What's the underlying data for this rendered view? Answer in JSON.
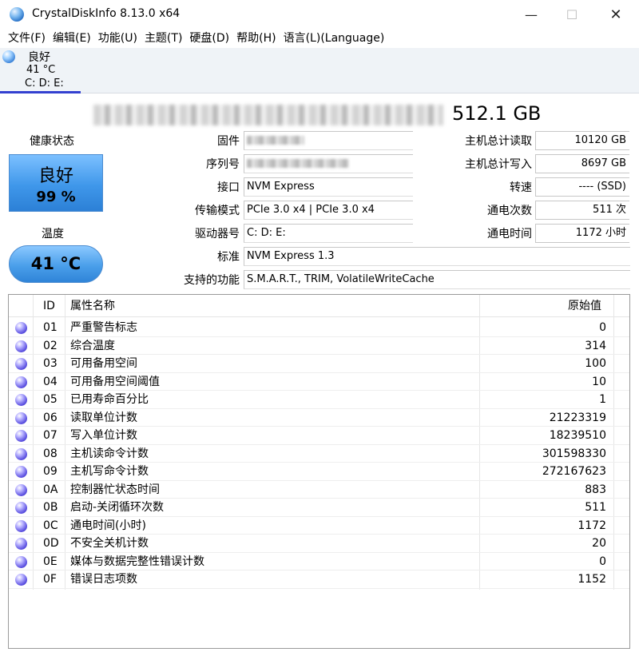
{
  "window": {
    "title": "CrystalDiskInfo 8.13.0 x64",
    "min_label": "—",
    "max_label": "☐",
    "close_label": "✕"
  },
  "menu": [
    "文件(F)",
    "编辑(E)",
    "功能(U)",
    "主题(T)",
    "硬盘(D)",
    "帮助(H)",
    "语言(L)(Language)"
  ],
  "drive_tab": {
    "status": "良好",
    "temp": "41 °C",
    "letters": "C: D: E:"
  },
  "disk": {
    "capacity": "512.1 GB",
    "health_label": "健康状态",
    "health_status": "良好",
    "health_percent": "99 %",
    "temp_label": "温度",
    "temperature": "41 °C"
  },
  "fields": {
    "firmware_label": "固件",
    "serial_label": "序列号",
    "interface_label": "接口",
    "interface": "NVM Express",
    "transfer_label": "传输模式",
    "transfer": "PCIe 3.0 x4 | PCIe 3.0 x4",
    "letter_label": "驱动器号",
    "letter": "C: D: E:",
    "standard_label": "标准",
    "standard": "NVM Express 1.3",
    "features_label": "支持的功能",
    "features": "S.M.A.R.T., TRIM, VolatileWriteCache"
  },
  "right_fields": {
    "host_reads_label": "主机总计读取",
    "host_reads": "10120 GB",
    "host_writes_label": "主机总计写入",
    "host_writes": "8697 GB",
    "rotation_label": "转速",
    "rotation": "---- (SSD)",
    "power_count_label": "通电次数",
    "power_count": "511 次",
    "power_hours_label": "通电时间",
    "power_hours": "1172 小时"
  },
  "smart": {
    "headers": {
      "id": "ID",
      "name": "属性名称",
      "raw": "原始值"
    },
    "rows": [
      {
        "id": "01",
        "name": "严重警告标志",
        "raw": "0"
      },
      {
        "id": "02",
        "name": "综合温度",
        "raw": "314"
      },
      {
        "id": "03",
        "name": "可用备用空间",
        "raw": "100"
      },
      {
        "id": "04",
        "name": "可用备用空间阈值",
        "raw": "10"
      },
      {
        "id": "05",
        "name": "已用寿命百分比",
        "raw": "1"
      },
      {
        "id": "06",
        "name": "读取单位计数",
        "raw": "21223319"
      },
      {
        "id": "07",
        "name": "写入单位计数",
        "raw": "18239510"
      },
      {
        "id": "08",
        "name": "主机读命令计数",
        "raw": "301598330"
      },
      {
        "id": "09",
        "name": "主机写命令计数",
        "raw": "272167623"
      },
      {
        "id": "0A",
        "name": "控制器忙状态时间",
        "raw": "883"
      },
      {
        "id": "0B",
        "name": "启动-关闭循环次数",
        "raw": "511"
      },
      {
        "id": "0C",
        "name": "通电时间(小时)",
        "raw": "1172"
      },
      {
        "id": "0D",
        "name": "不安全关机计数",
        "raw": "20"
      },
      {
        "id": "0E",
        "name": "媒体与数据完整性错误计数",
        "raw": "0"
      },
      {
        "id": "0F",
        "name": "错误日志项数",
        "raw": "1152"
      }
    ]
  }
}
